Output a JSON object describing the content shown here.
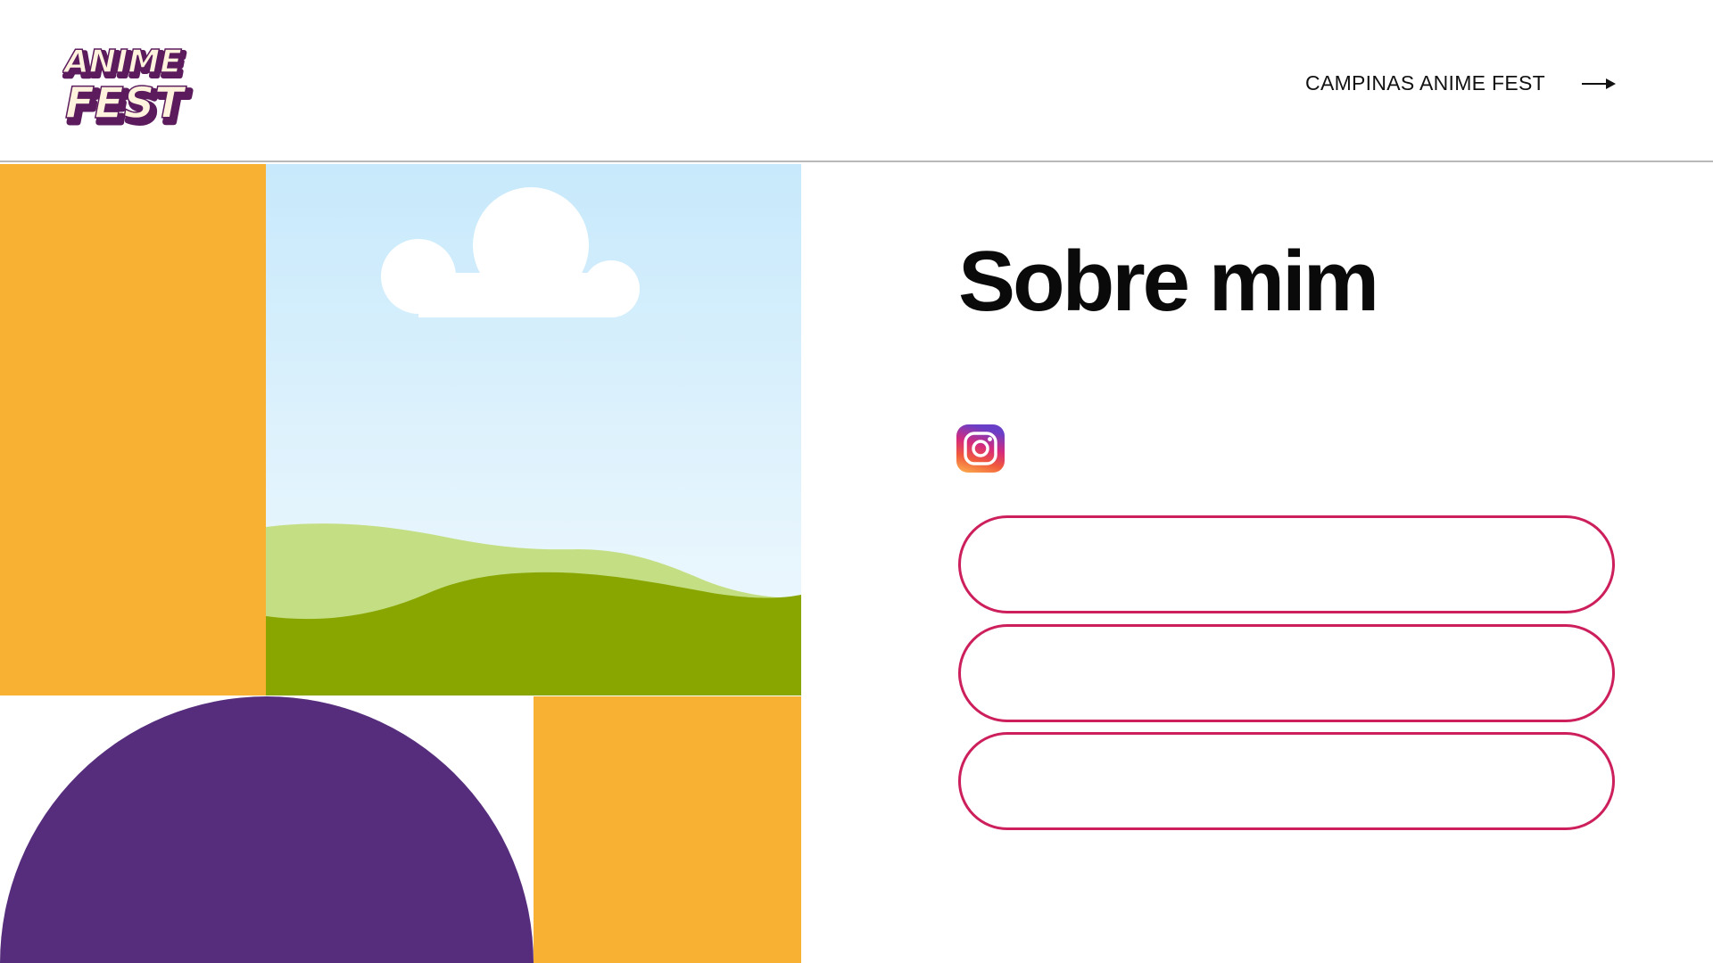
{
  "header": {
    "logo_line1": "ANIME",
    "logo_line2": "FEST",
    "nav_label": "CAMPINAS ANIME FEST",
    "nav_icon": "arrow-right-icon"
  },
  "main": {
    "title": "Sobre mim",
    "social_icon": "instagram-icon",
    "link_buttons": [
      {
        "label": ""
      },
      {
        "label": ""
      },
      {
        "label": ""
      }
    ]
  },
  "colors": {
    "orange": "#F8B133",
    "purple": "#562D7C",
    "sky_top": "#C7E9FB",
    "sky_bottom": "#F3FAFE",
    "hill_light": "#C4DF83",
    "hill_dark": "#89A600",
    "button_border": "#CC1F5C",
    "logo_purple": "#5B1B5C",
    "logo_cream": "#FFF3DD"
  }
}
